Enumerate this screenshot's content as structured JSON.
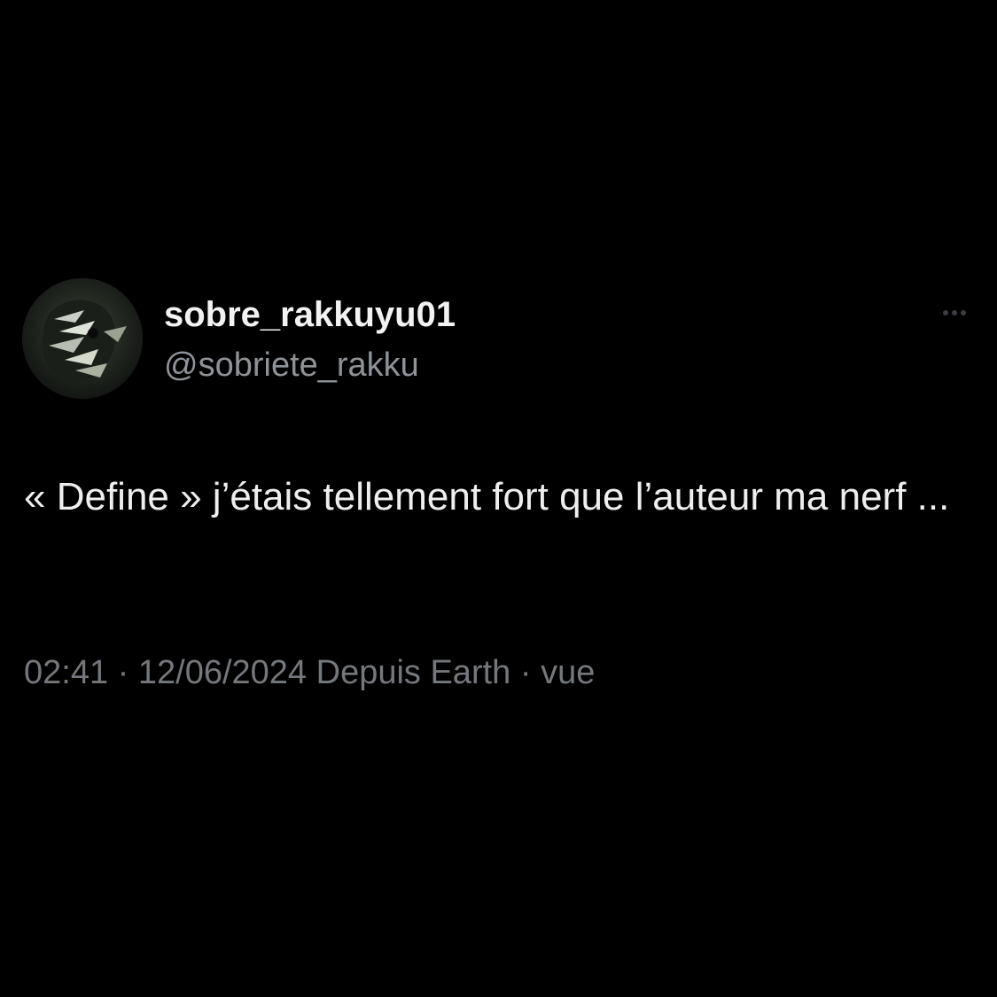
{
  "tweet": {
    "author": {
      "display_name": "sobre_rakkuyu01",
      "handle": "@sobriete_rakku",
      "avatar_icon": "avatar-image"
    },
    "more_icon": "more-horizontal-icon",
    "text": "« Define » j’étais tellement fort que l’auteur ma nerf ...",
    "meta": {
      "time": "02:41",
      "separator_1": " · ",
      "date": "12/06/2024",
      "source": " Depuis Earth",
      "separator_2": " · ",
      "views": "vue"
    }
  },
  "colors": {
    "background": "#000000",
    "text_primary": "#eeeeee",
    "text_secondary": "#8e9399",
    "meta_text": "#74787d"
  }
}
